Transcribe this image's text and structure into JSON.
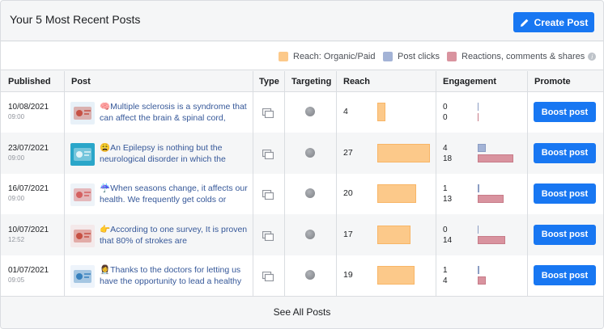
{
  "header": {
    "title": "Your 5 Most Recent Posts",
    "create_button": "Create Post"
  },
  "legend": [
    {
      "label": "Reach: Organic/Paid",
      "color": "#fcc98a"
    },
    {
      "label": "Post clicks",
      "color": "#a3b3d6"
    },
    {
      "label": "Reactions, comments & shares",
      "color": "#d9939f"
    }
  ],
  "columns": {
    "published": "Published",
    "post": "Post",
    "type": "Type",
    "targeting": "Targeting",
    "reach": "Reach",
    "engagement": "Engagement",
    "promote": "Promote"
  },
  "max_reach": 27,
  "max_engagement": 18,
  "posts": [
    {
      "date": "10/08/2021",
      "time": "09:00",
      "emoji": "🧠",
      "text": "Multiple sclerosis is a syndrome that can affect the brain & spinal cord,",
      "reach": "4",
      "clicks": "0",
      "reactions": "0",
      "boost_label": "Boost post",
      "thumb_icon": "brain-thumbnail"
    },
    {
      "date": "23/07/2021",
      "time": "09:00",
      "emoji": "😩",
      "text": "An Epilepsy is nothing but the neurological disorder in which the",
      "reach": "27",
      "clicks": "4",
      "reactions": "18",
      "boost_label": "Boost post",
      "thumb_icon": "epilepsy-thumbnail"
    },
    {
      "date": "16/07/2021",
      "time": "09:00",
      "emoji": "☔",
      "text": "When seasons change, it affects our health. We frequently get colds or",
      "reach": "20",
      "clicks": "1",
      "reactions": "13",
      "boost_label": "Boost post",
      "thumb_icon": "monsoon-thumbnail"
    },
    {
      "date": "10/07/2021",
      "time": "12:52",
      "emoji": "👉",
      "text": "According to one survey, It is proven that 80% of strokes are",
      "reach": "17",
      "clicks": "0",
      "reactions": "14",
      "boost_label": "Boost post",
      "thumb_icon": "stroke-thumbnail"
    },
    {
      "date": "01/07/2021",
      "time": "09:05",
      "emoji": "👩‍⚕️",
      "text": "Thanks to the doctors for letting us have the opportunity to lead a healthy",
      "reach": "19",
      "clicks": "1",
      "reactions": "4",
      "boost_label": "Boost post",
      "thumb_icon": "doctors-day-thumbnail"
    }
  ],
  "footer": {
    "see_all": "See All Posts"
  }
}
